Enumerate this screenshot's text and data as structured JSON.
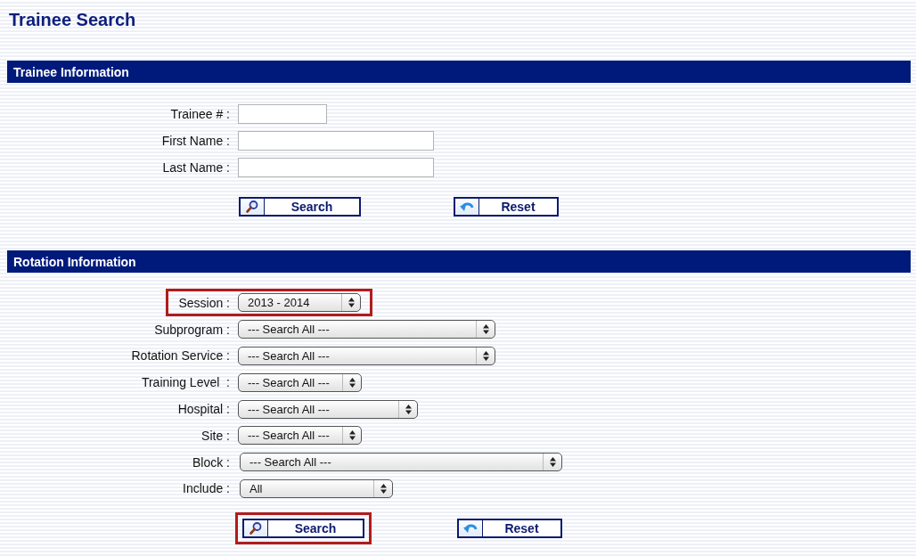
{
  "page_title": "Trainee Search",
  "trainee_section": {
    "title": "Trainee Information",
    "fields": [
      {
        "label": "Trainee # :"
      },
      {
        "label": "First Name :"
      },
      {
        "label": "Last Name :"
      }
    ],
    "buttons": [
      {
        "label": "Search",
        "kind": "search",
        "highlighted": false
      },
      {
        "label": "Reset",
        "kind": "reset",
        "highlighted": false
      }
    ]
  },
  "rotation_section": {
    "title": "Rotation Information",
    "selects": [
      {
        "label": "Session :",
        "value": "2013 - 2014",
        "highlighted": true
      },
      {
        "label": "Subprogram :",
        "value": "--- Search All ---",
        "highlighted": false
      },
      {
        "label": "Rotation Service :",
        "value": "--- Search All ---",
        "highlighted": false
      },
      {
        "label": "Training Level  :",
        "value": "--- Search All ---",
        "highlighted": false
      },
      {
        "label": "Hospital :",
        "value": "--- Search All ---",
        "highlighted": false
      },
      {
        "label": "Site :",
        "value": "--- Search All ---",
        "highlighted": false
      },
      {
        "label": "Block :",
        "value": "--- Search All ---",
        "highlighted": false
      },
      {
        "label": "Include :",
        "value": "All",
        "highlighted": false
      }
    ],
    "buttons": [
      {
        "label": "Search",
        "kind": "search",
        "highlighted": true
      },
      {
        "label": "Reset",
        "kind": "reset",
        "highlighted": false
      }
    ]
  }
}
